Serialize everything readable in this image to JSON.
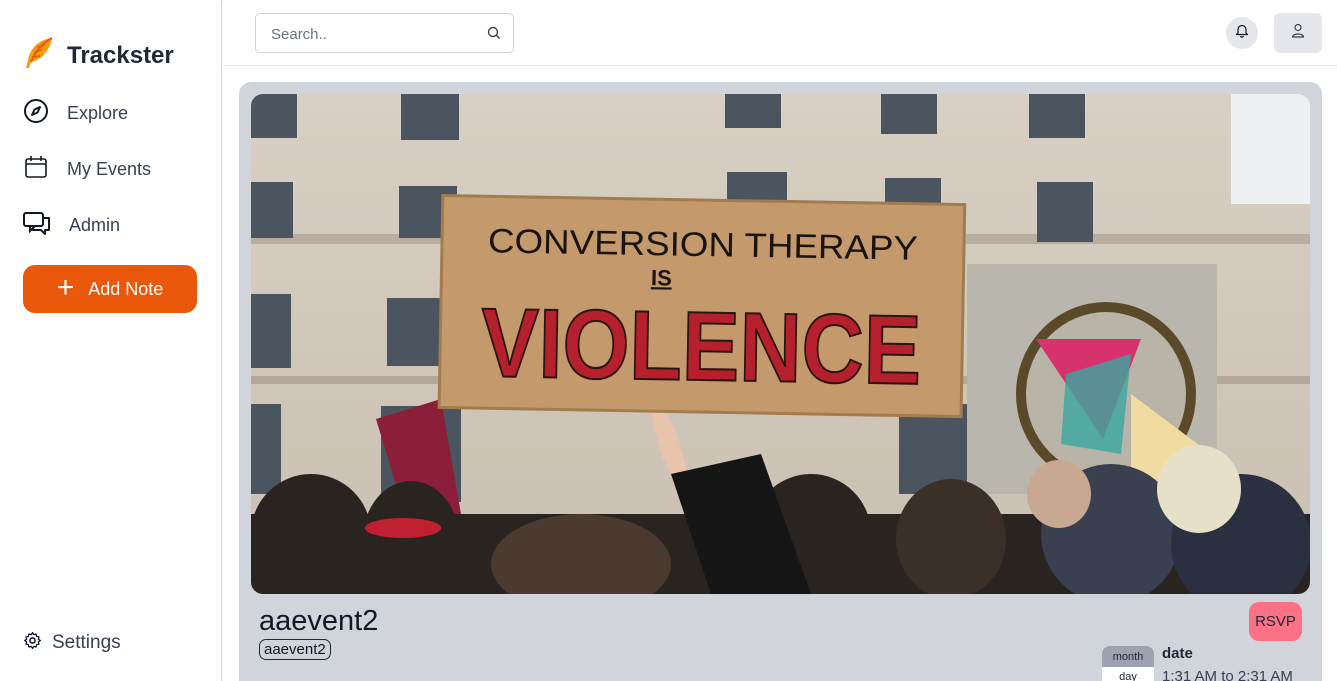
{
  "app": {
    "name": "Trackster",
    "accent": "#ea580c"
  },
  "sidebar": {
    "items": [
      {
        "label": "Explore",
        "icon": "compass-icon"
      },
      {
        "label": "My Events",
        "icon": "calendar-icon"
      },
      {
        "label": "Admin",
        "icon": "chat-bubbles-icon"
      }
    ],
    "add_label": "Add Note",
    "settings_label": "Settings"
  },
  "search": {
    "placeholder": "Search.."
  },
  "event": {
    "title": "aaevent2",
    "tag": "aaevent2",
    "rsvp_label": "RSVP",
    "rsvp_color": "#fb7185",
    "month_label": "month",
    "day_label": "day",
    "date_label": "date",
    "time_range": "1:31 AM to 2:31 AM",
    "image": {
      "description": "protest photo",
      "sign_line1": "CONVERSION THERAPY",
      "sign_line2": "IS",
      "sign_line3": "VIOLENCE"
    }
  }
}
